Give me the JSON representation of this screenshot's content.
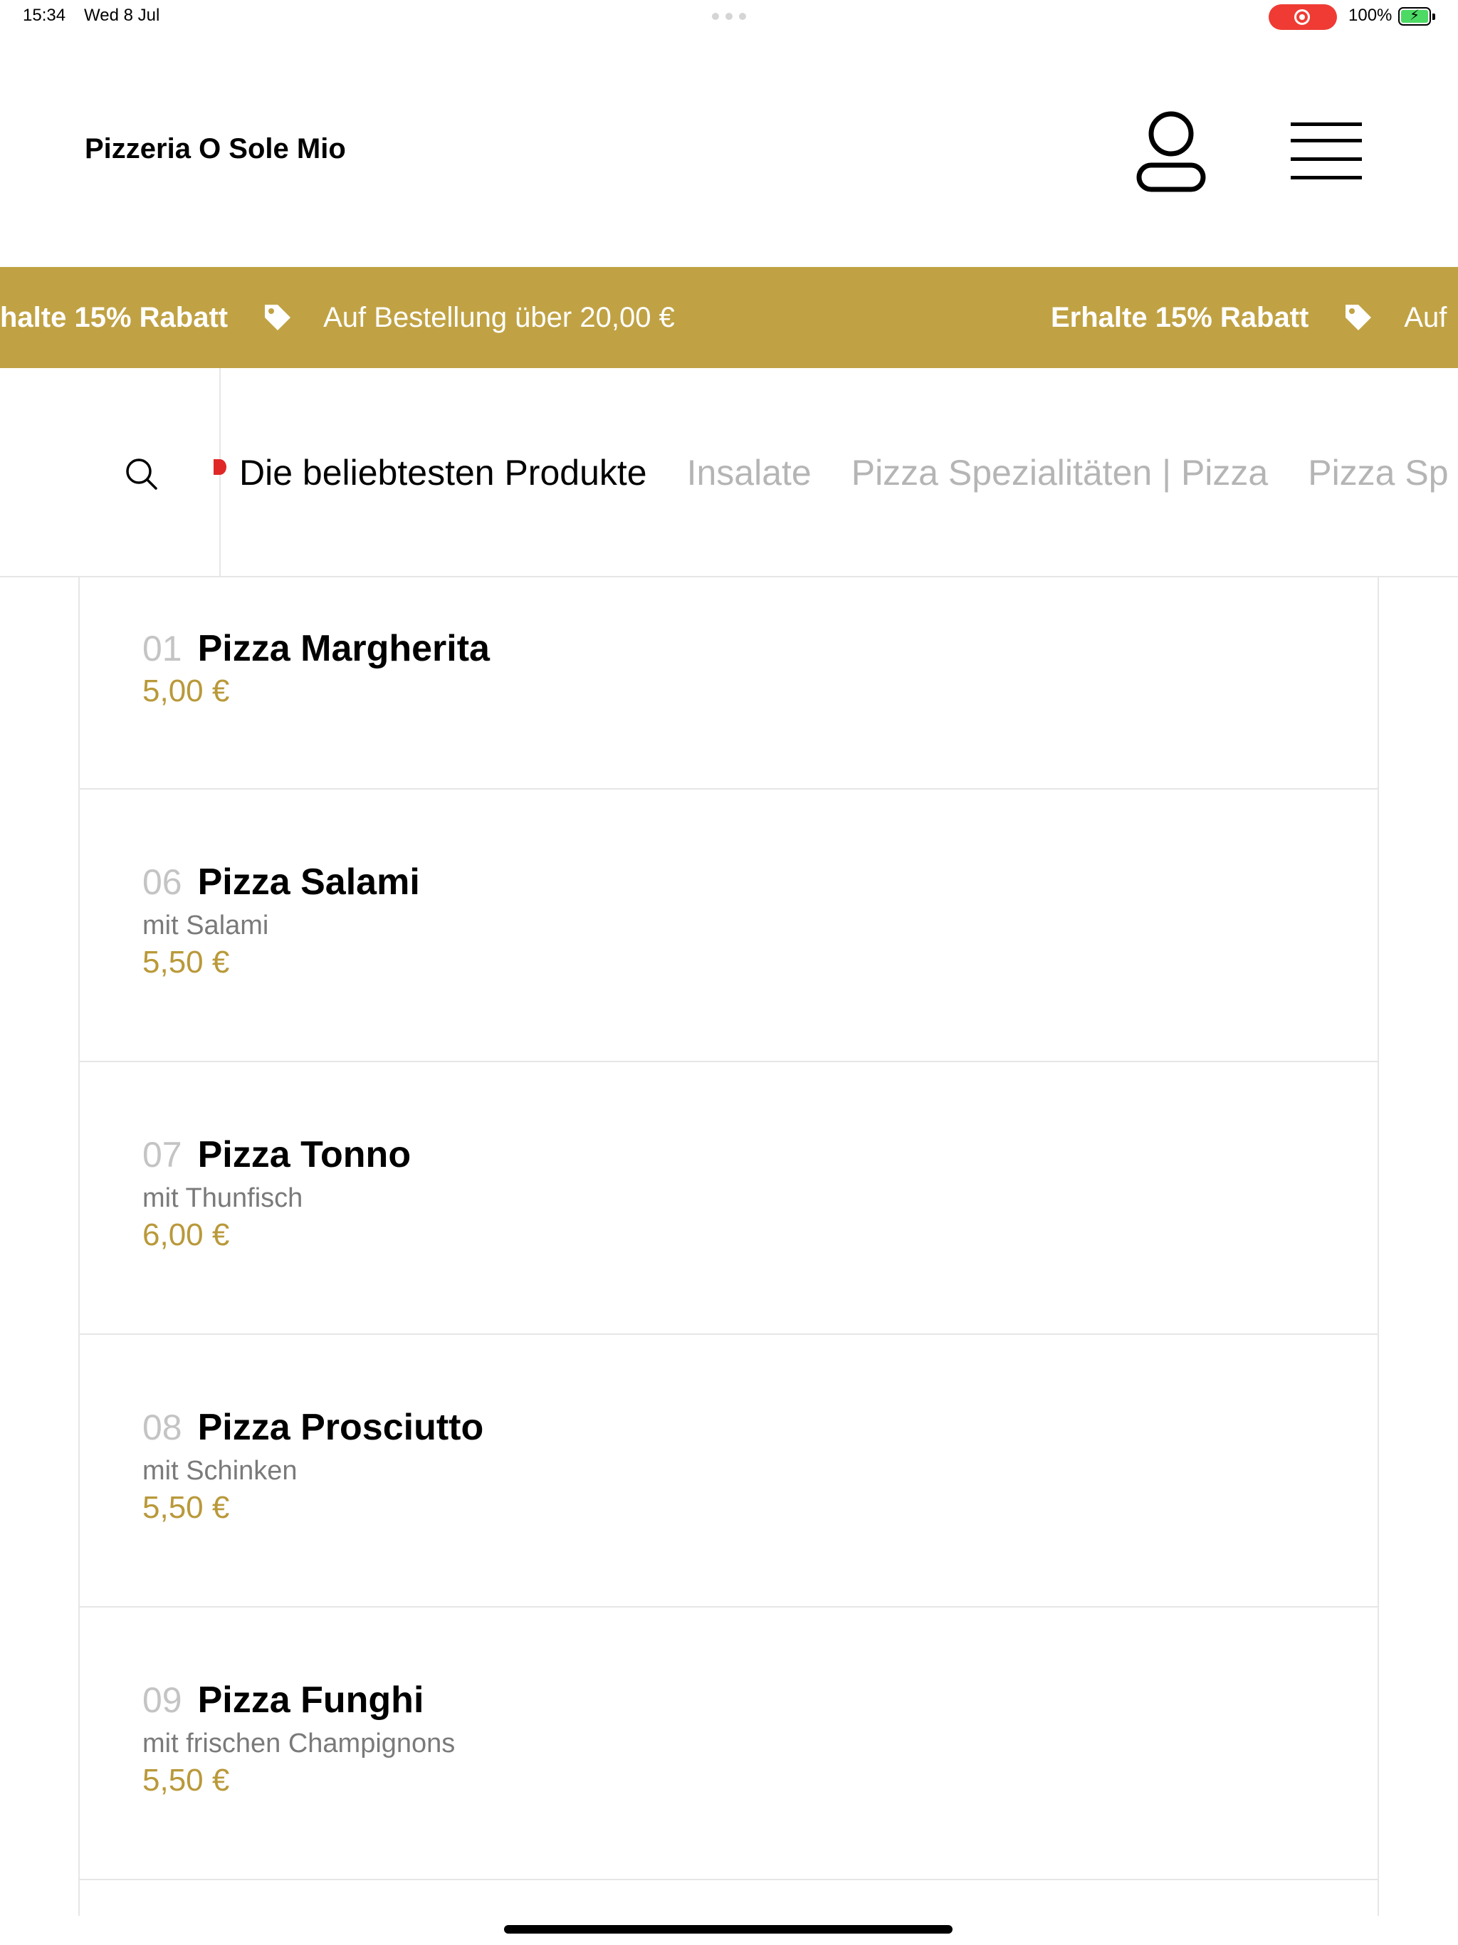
{
  "status_bar": {
    "time": "15:34",
    "date": "Wed 8 Jul",
    "battery": "100%"
  },
  "header": {
    "brand": "Pizzeria O Sole Mio",
    "icons": {
      "user": "user-icon",
      "menu": "hamburger-menu-icon"
    }
  },
  "promo": {
    "discount": "Erhalte 15% Rabatt",
    "condition": "Auf Bestellung über 20,00 €",
    "discount_partial": "halte 15% Rabatt",
    "condition_partial": "Auf",
    "icon": "tag-icon",
    "color": "#c0a244"
  },
  "categories": {
    "search_icon": "search-icon",
    "tabs": [
      {
        "label": "Die beliebtesten Produkte"
      },
      {
        "label": "Insalate"
      },
      {
        "label": "Pizza Spezialitäten | Pizza"
      },
      {
        "label": "Pizza Sp"
      }
    ]
  },
  "products": [
    {
      "number": "01",
      "name": "Pizza Margherita",
      "description": "",
      "price": "5,00 €"
    },
    {
      "number": "06",
      "name": "Pizza Salami",
      "description": "mit Salami",
      "price": "5,50 €"
    },
    {
      "number": "07",
      "name": "Pizza Tonno",
      "description": "mit Thunfisch",
      "price": "6,00 €"
    },
    {
      "number": "08",
      "name": "Pizza Prosciutto",
      "description": "mit Schinken",
      "price": "5,50 €"
    },
    {
      "number": "09",
      "name": "Pizza Funghi",
      "description": "mit frischen Champignons",
      "price": "5,50 €"
    }
  ],
  "colors": {
    "accent": "#c0a244",
    "price": "#b9993a",
    "active_dot": "#e02727"
  }
}
